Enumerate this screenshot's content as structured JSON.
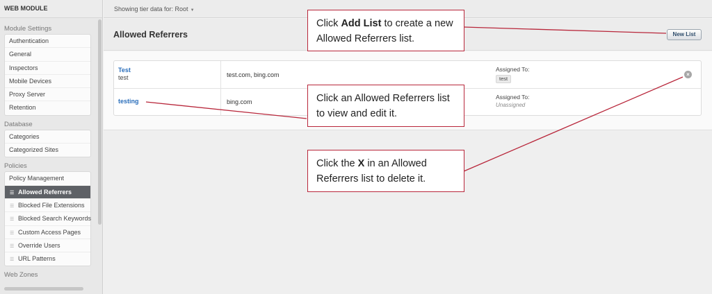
{
  "sidebar": {
    "header": "WEB MODULE",
    "sections": [
      {
        "title": "Module Settings",
        "items": [
          "Authentication",
          "General",
          "Inspectors",
          "Mobile Devices",
          "Proxy Server",
          "Retention"
        ]
      },
      {
        "title": "Database",
        "items": [
          "Categories",
          "Categorized Sites"
        ]
      },
      {
        "title": "Policies",
        "items": [
          "Policy Management"
        ],
        "sub_items": [
          "Allowed Referrers",
          "Blocked File Extensions",
          "Blocked Search Keywords",
          "Custom Access Pages",
          "Override Users",
          "URL Patterns"
        ],
        "active_sub_item": "Allowed Referrers"
      },
      {
        "title": "Web Zones"
      }
    ]
  },
  "topbar": {
    "tier_text": "Showing tier data for: Root"
  },
  "main": {
    "title": "Allowed Referrers",
    "new_list_label": "New List",
    "rows": [
      {
        "name": "Test",
        "description": "test",
        "referrers": "test.com, bing.com",
        "assigned_label": "Assigned To:",
        "assigned_tag": "test"
      },
      {
        "name": "testing",
        "description": "",
        "referrers": "bing.com",
        "assigned_label": "Assigned To:",
        "assigned_none": "Unassigned"
      }
    ]
  },
  "callouts": {
    "add": {
      "pre": "Click ",
      "bold": "Add List",
      "post": " to create a new Allowed Referrers list."
    },
    "view": {
      "text": "Click an Allowed Referrers list to view and edit it."
    },
    "delete": {
      "pre": "Click the ",
      "bold": "X",
      "post": " in an Allowed Referrers list to delete it."
    }
  },
  "colors": {
    "accent_link": "#2a6ebb",
    "callout_border": "#b8263a",
    "active_item_bg": "#5e6166"
  }
}
